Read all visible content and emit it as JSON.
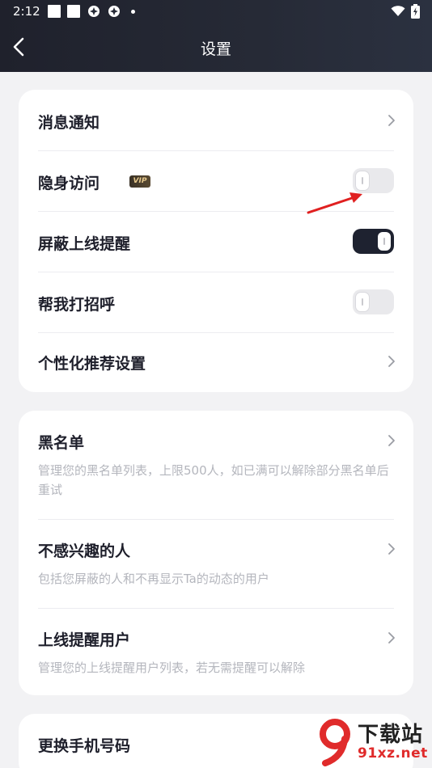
{
  "status_bar": {
    "time": "2:12",
    "icons": [
      "notification-square-icon",
      "notification-square-icon",
      "app-notification-icon",
      "app-notification-icon",
      "more-notifications-dot-icon",
      "wifi-icon",
      "battery-charging-icon"
    ]
  },
  "header": {
    "title": "设置",
    "back_icon": "chevron-left-icon"
  },
  "card1": {
    "items": [
      {
        "label": "消息通知",
        "control": "chevron"
      },
      {
        "label": "隐身访问",
        "badge": "VIP",
        "control": "toggle",
        "state": "off"
      },
      {
        "label": "屏蔽上线提醒",
        "control": "toggle",
        "state": "on"
      },
      {
        "label": "帮我打招呼",
        "control": "toggle",
        "state": "off"
      },
      {
        "label": "个性化推荐设置",
        "control": "chevron"
      }
    ]
  },
  "card2": {
    "items": [
      {
        "label": "黑名单",
        "desc": "管理您的黑名单列表，上限500人，如已满可以解除部分黑名单后重试"
      },
      {
        "label": "不感兴趣的人",
        "desc": "包括您屏蔽的人和不再显示Ta的动态的用户"
      },
      {
        "label": "上线提醒用户",
        "desc": "管理您的上线提醒用户列表，若无需提醒可以解除"
      }
    ]
  },
  "card3": {
    "items": [
      {
        "label": "更换手机号码"
      }
    ]
  },
  "annotation": {
    "icon": "red-arrow-icon",
    "color": "#e02020"
  },
  "watermark": {
    "title": "下载站",
    "url": "91xz.net",
    "logo_icon": "nine-logo-icon"
  },
  "colors": {
    "header_bg": "#1f212c",
    "toggle_on": "#1e2230",
    "toggle_off": "#e9e9ec",
    "accent_red": "#e02b2b",
    "vip_gold": "#e7c98d"
  }
}
